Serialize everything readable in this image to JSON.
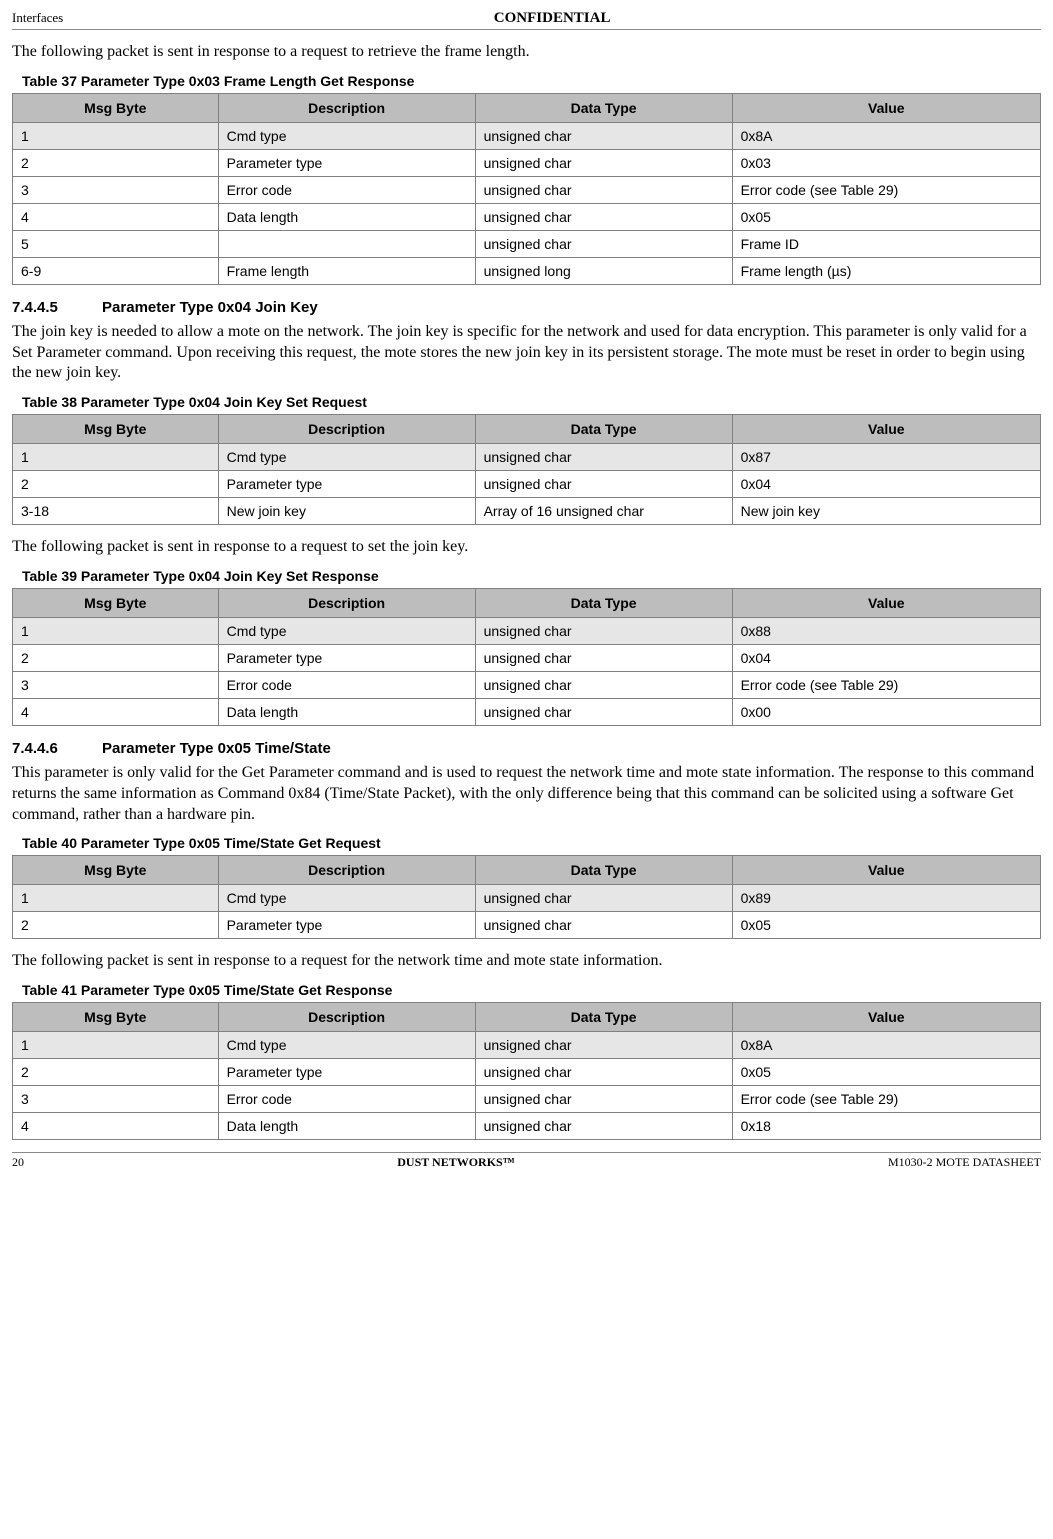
{
  "header": {
    "left": "Interfaces",
    "center": "CONFIDENTIAL"
  },
  "intro37": "The following packet is sent in response to a request to retrieve the frame length.",
  "table37": {
    "caption": "Table 37    Parameter Type 0x03 Frame Length Get Response",
    "headers": [
      "Msg Byte",
      "Description",
      "Data Type",
      "Value"
    ],
    "rows": [
      [
        "1",
        "Cmd type",
        "unsigned char",
        "0x8A"
      ],
      [
        "2",
        "Parameter type",
        "unsigned char",
        "0x03"
      ],
      [
        "3",
        "Error code",
        "unsigned char",
        "Error code (see Table 29)"
      ],
      [
        "4",
        "Data length",
        "unsigned char",
        "0x05"
      ],
      [
        "5",
        "",
        "unsigned char",
        "Frame ID"
      ],
      [
        "6-9",
        "Frame length",
        "unsigned long",
        "Frame length (µs)"
      ]
    ]
  },
  "sec7445": {
    "num": "7.4.4.5",
    "title": "Parameter Type 0x04 Join Key",
    "text": "The join key is needed to allow a mote on the network. The join key is specific for the network and used for data encryption. This parameter is only valid for a Set Parameter command. Upon receiving this request, the mote stores the new join key in its persistent storage. The mote must be reset in order to begin using the new join key."
  },
  "table38": {
    "caption": "Table 38    Parameter Type 0x04 Join Key Set Request",
    "headers": [
      "Msg Byte",
      "Description",
      "Data Type",
      "Value"
    ],
    "rows": [
      [
        "1",
        "Cmd type",
        "unsigned char",
        "0x87"
      ],
      [
        "2",
        "Parameter type",
        "unsigned char",
        "0x04"
      ],
      [
        "3-18",
        "New join key",
        "Array of 16 unsigned char",
        "New join key"
      ]
    ]
  },
  "intro39": "The following packet is sent in response to a request to set the join key.",
  "table39": {
    "caption": "Table 39    Parameter Type 0x04 Join Key Set Response",
    "headers": [
      "Msg Byte",
      "Description",
      "Data Type",
      "Value"
    ],
    "rows": [
      [
        "1",
        "Cmd type",
        "unsigned char",
        "0x88"
      ],
      [
        "2",
        "Parameter type",
        "unsigned char",
        "0x04"
      ],
      [
        "3",
        "Error code",
        "unsigned char",
        "Error code (see Table 29)"
      ],
      [
        "4",
        "Data length",
        "unsigned char",
        " 0x00"
      ]
    ]
  },
  "sec7446": {
    "num": "7.4.4.6",
    "title": "Parameter Type 0x05 Time/State",
    "text": "This parameter is only valid for the Get Parameter command and is used to request the network time and mote state information. The response to this command returns the same information as Command 0x84 (Time/State Packet), with the only difference being that this command can be solicited using a software Get command, rather than a hardware pin."
  },
  "table40": {
    "caption": "Table 40    Parameter Type 0x05 Time/State Get Request",
    "headers": [
      "Msg Byte",
      "Description",
      "Data Type",
      "Value"
    ],
    "rows": [
      [
        "1",
        "Cmd type",
        "unsigned char",
        "0x89"
      ],
      [
        "2",
        "Parameter type",
        "unsigned char",
        "0x05"
      ]
    ]
  },
  "intro41": "The following packet is sent in response to a request for the network time and mote state information.",
  "table41": {
    "caption": "Table 41    Parameter Type 0x05 Time/State Get Response",
    "headers": [
      "Msg Byte",
      "Description",
      "Data Type",
      "Value"
    ],
    "rows": [
      [
        "1",
        "Cmd type",
        "unsigned char",
        "0x8A"
      ],
      [
        "2",
        "Parameter type",
        "unsigned char",
        "0x05"
      ],
      [
        "3",
        "Error code",
        "unsigned char",
        "Error code (see Table 29)"
      ],
      [
        "4",
        "Data length",
        "unsigned char",
        "0x18"
      ]
    ]
  },
  "footer": {
    "left": "20",
    "center": "DUST NETWORKS™",
    "right": "M1030-2 MOTE DATASHEET"
  }
}
